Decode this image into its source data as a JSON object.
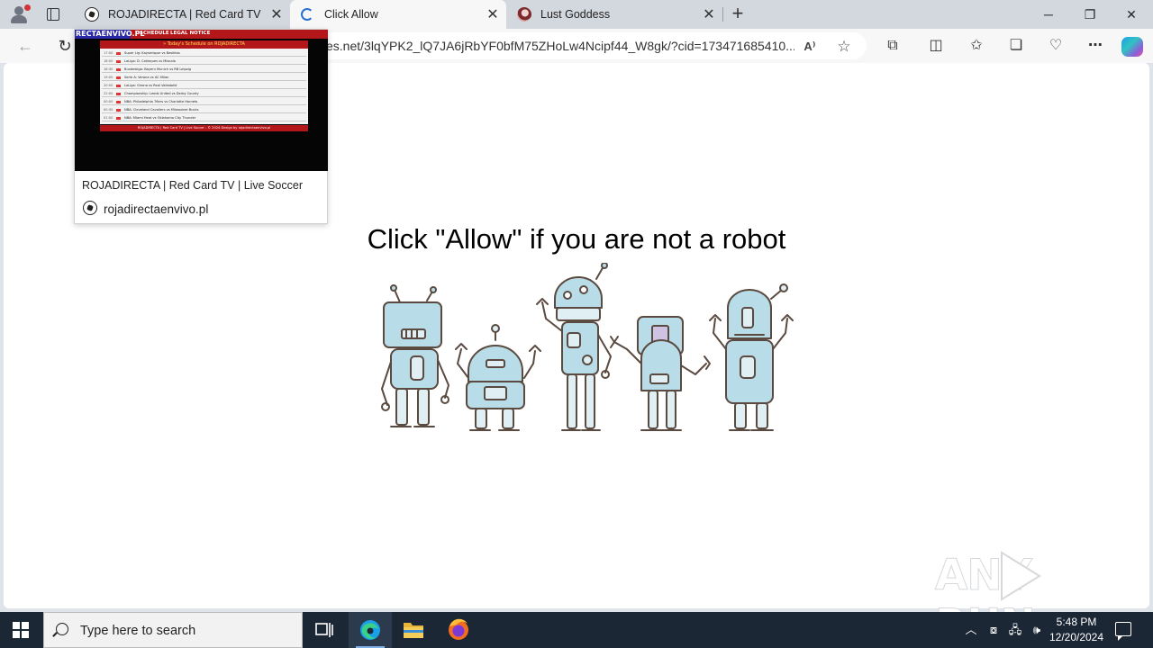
{
  "browser": {
    "tabs": [
      {
        "title": "ROJADIRECTA | Red Card TV | Live Soccer",
        "favicon": "soccer-ball-icon",
        "active": false
      },
      {
        "title": "Click Allow",
        "favicon": "loading-icon",
        "active": true
      },
      {
        "title": "Lust Goddess",
        "favicon": "lust-goddess-icon",
        "active": false
      }
    ],
    "address_bar": {
      "url": "es.net/3lqYPK2_lQ7JA6jRbYF0bfM75ZHoLw4Ncipf44_W8gk/?cid=173471685410..."
    },
    "hover_card": {
      "thumbnail": {
        "brand": "RECTAENVIVO.PL",
        "nav": [
          "SCHEDULE",
          "LEGAL NOTICE"
        ],
        "heading": "» Today's Schedule on ROJADIRECTA",
        "rows": [
          {
            "time": "17:00",
            "event": "Super Lig: Kayserispor vs Besiktas"
          },
          {
            "time": "18:00",
            "event": "LaLiga: D. Cañeques vs Mlacalo"
          },
          {
            "time": "18:30",
            "event": "Bundesliga: Bayern Munich vs RB Leipzig"
          },
          {
            "time": "19:00",
            "event": "Serie A: Verona vs AC Milan"
          },
          {
            "time": "20:00",
            "event": "LaLiga: Girona vs Real Valladolid"
          },
          {
            "time": "22:00",
            "event": "Championship: Leeds United vs Derby County"
          },
          {
            "time": "00:00",
            "event": "NBA: Philadelphia 76ers vs Charlotte Hornets"
          },
          {
            "time": "00:30",
            "event": "NBA: Cleveland Cavaliers vs Milwaukee Bucks"
          },
          {
            "time": "01:00",
            "event": "NBA: Miami Heat vs Oklahoma City Thunder"
          }
        ],
        "footer": "ROJADIRECTA | Red Card TV | Live Soccer - © 2024 Design by rojadirectaenvivo.pl"
      },
      "title": "ROJADIRECTA | Red Card TV | Live Soccer",
      "domain": "rojadirectaenvivo.pl"
    }
  },
  "page": {
    "headline": "Click \"Allow\" if you are not a robot",
    "illustration": "robots-illustration",
    "watermark": "ANY RUN"
  },
  "taskbar": {
    "search_placeholder": "Type here to search",
    "time": "5:48 PM",
    "date": "12/20/2024"
  },
  "colors": {
    "accent": "#2b6fd1",
    "taskbar": "#1c2735",
    "tab_strip": "#d3d7de",
    "thumbnail_red": "#b3171a"
  }
}
